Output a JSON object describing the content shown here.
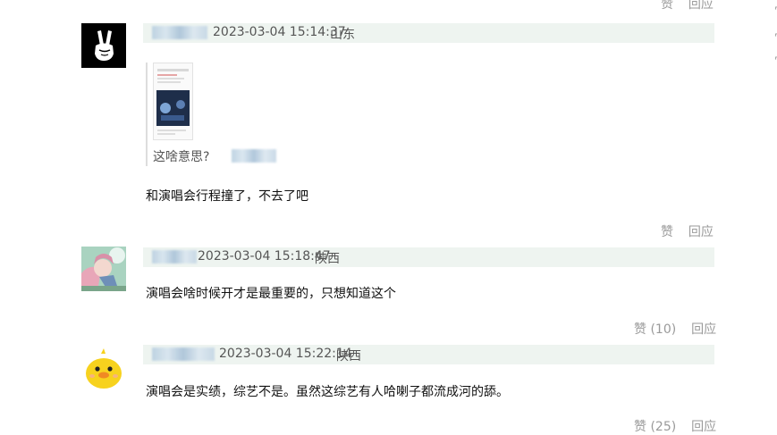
{
  "top_actions": {
    "like_label": "赞",
    "reply_label": "回应"
  },
  "comments": [
    {
      "timestamp": "2023-03-04 15:14:37",
      "location": "山东",
      "quote": {
        "text": "这啥意思?"
      },
      "text": "和演唱会行程撞了，不去了吧",
      "like_label": "赞",
      "reply_label": "回应"
    },
    {
      "timestamp": "2023-03-04 15:18:47",
      "location": "陕西",
      "text": "演唱会啥时候开才是最重要的，只想知道这个",
      "like_label": "赞 (10)",
      "reply_label": "回应"
    },
    {
      "timestamp": "2023-03-04 15:22:14",
      "location": "陕西",
      "text": "演唱会是实绩，综艺不是。虽然这综艺有人哈喇子都流成河的舔。",
      "like_label": "赞 (25)",
      "reply_label": "回应"
    }
  ],
  "icons": {
    "avatar_1": "peace-hand-icon",
    "avatar_2": "anime-girl-icon",
    "avatar_3": "yellow-duck-icon"
  }
}
